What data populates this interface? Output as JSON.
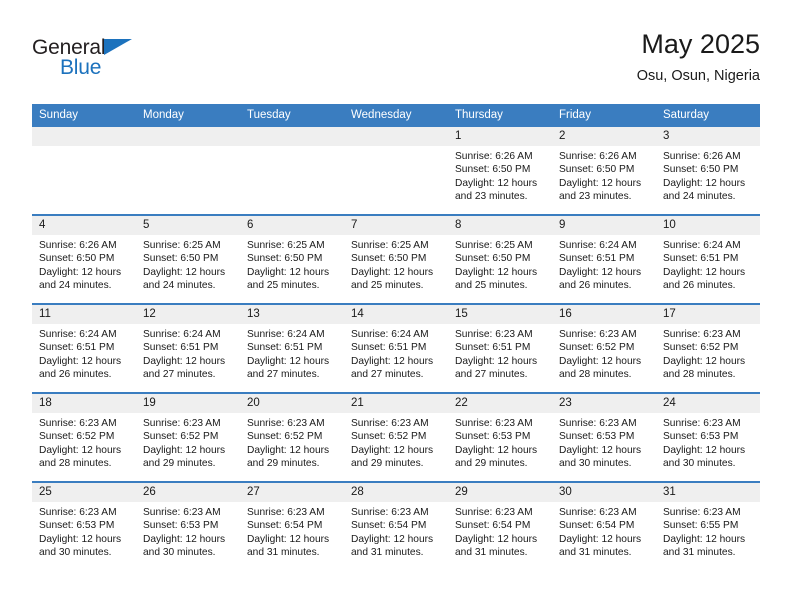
{
  "brand": {
    "name_part1": "General",
    "name_part2": "Blue",
    "triangle_icon": "triangle-icon",
    "accent_color": "#1c72bd"
  },
  "header": {
    "title": "May 2025",
    "location": "Osu, Osun, Nigeria"
  },
  "calendar": {
    "header_background": "#3a7dc0",
    "daynum_background": "#efefef",
    "weekday_headers": [
      "Sunday",
      "Monday",
      "Tuesday",
      "Wednesday",
      "Thursday",
      "Friday",
      "Saturday"
    ],
    "weeks": [
      [
        {
          "day": "",
          "sunrise": "",
          "sunset": "",
          "daylight": "",
          "empty": true
        },
        {
          "day": "",
          "sunrise": "",
          "sunset": "",
          "daylight": "",
          "empty": true
        },
        {
          "day": "",
          "sunrise": "",
          "sunset": "",
          "daylight": "",
          "empty": true
        },
        {
          "day": "",
          "sunrise": "",
          "sunset": "",
          "daylight": "",
          "empty": true
        },
        {
          "day": "1",
          "sunrise": "Sunrise: 6:26 AM",
          "sunset": "Sunset: 6:50 PM",
          "daylight": "Daylight: 12 hours and 23 minutes."
        },
        {
          "day": "2",
          "sunrise": "Sunrise: 6:26 AM",
          "sunset": "Sunset: 6:50 PM",
          "daylight": "Daylight: 12 hours and 23 minutes."
        },
        {
          "day": "3",
          "sunrise": "Sunrise: 6:26 AM",
          "sunset": "Sunset: 6:50 PM",
          "daylight": "Daylight: 12 hours and 24 minutes."
        }
      ],
      [
        {
          "day": "4",
          "sunrise": "Sunrise: 6:26 AM",
          "sunset": "Sunset: 6:50 PM",
          "daylight": "Daylight: 12 hours and 24 minutes."
        },
        {
          "day": "5",
          "sunrise": "Sunrise: 6:25 AM",
          "sunset": "Sunset: 6:50 PM",
          "daylight": "Daylight: 12 hours and 24 minutes."
        },
        {
          "day": "6",
          "sunrise": "Sunrise: 6:25 AM",
          "sunset": "Sunset: 6:50 PM",
          "daylight": "Daylight: 12 hours and 25 minutes."
        },
        {
          "day": "7",
          "sunrise": "Sunrise: 6:25 AM",
          "sunset": "Sunset: 6:50 PM",
          "daylight": "Daylight: 12 hours and 25 minutes."
        },
        {
          "day": "8",
          "sunrise": "Sunrise: 6:25 AM",
          "sunset": "Sunset: 6:50 PM",
          "daylight": "Daylight: 12 hours and 25 minutes."
        },
        {
          "day": "9",
          "sunrise": "Sunrise: 6:24 AM",
          "sunset": "Sunset: 6:51 PM",
          "daylight": "Daylight: 12 hours and 26 minutes."
        },
        {
          "day": "10",
          "sunrise": "Sunrise: 6:24 AM",
          "sunset": "Sunset: 6:51 PM",
          "daylight": "Daylight: 12 hours and 26 minutes."
        }
      ],
      [
        {
          "day": "11",
          "sunrise": "Sunrise: 6:24 AM",
          "sunset": "Sunset: 6:51 PM",
          "daylight": "Daylight: 12 hours and 26 minutes."
        },
        {
          "day": "12",
          "sunrise": "Sunrise: 6:24 AM",
          "sunset": "Sunset: 6:51 PM",
          "daylight": "Daylight: 12 hours and 27 minutes."
        },
        {
          "day": "13",
          "sunrise": "Sunrise: 6:24 AM",
          "sunset": "Sunset: 6:51 PM",
          "daylight": "Daylight: 12 hours and 27 minutes."
        },
        {
          "day": "14",
          "sunrise": "Sunrise: 6:24 AM",
          "sunset": "Sunset: 6:51 PM",
          "daylight": "Daylight: 12 hours and 27 minutes."
        },
        {
          "day": "15",
          "sunrise": "Sunrise: 6:23 AM",
          "sunset": "Sunset: 6:51 PM",
          "daylight": "Daylight: 12 hours and 27 minutes."
        },
        {
          "day": "16",
          "sunrise": "Sunrise: 6:23 AM",
          "sunset": "Sunset: 6:52 PM",
          "daylight": "Daylight: 12 hours and 28 minutes."
        },
        {
          "day": "17",
          "sunrise": "Sunrise: 6:23 AM",
          "sunset": "Sunset: 6:52 PM",
          "daylight": "Daylight: 12 hours and 28 minutes."
        }
      ],
      [
        {
          "day": "18",
          "sunrise": "Sunrise: 6:23 AM",
          "sunset": "Sunset: 6:52 PM",
          "daylight": "Daylight: 12 hours and 28 minutes."
        },
        {
          "day": "19",
          "sunrise": "Sunrise: 6:23 AM",
          "sunset": "Sunset: 6:52 PM",
          "daylight": "Daylight: 12 hours and 29 minutes."
        },
        {
          "day": "20",
          "sunrise": "Sunrise: 6:23 AM",
          "sunset": "Sunset: 6:52 PM",
          "daylight": "Daylight: 12 hours and 29 minutes."
        },
        {
          "day": "21",
          "sunrise": "Sunrise: 6:23 AM",
          "sunset": "Sunset: 6:52 PM",
          "daylight": "Daylight: 12 hours and 29 minutes."
        },
        {
          "day": "22",
          "sunrise": "Sunrise: 6:23 AM",
          "sunset": "Sunset: 6:53 PM",
          "daylight": "Daylight: 12 hours and 29 minutes."
        },
        {
          "day": "23",
          "sunrise": "Sunrise: 6:23 AM",
          "sunset": "Sunset: 6:53 PM",
          "daylight": "Daylight: 12 hours and 30 minutes."
        },
        {
          "day": "24",
          "sunrise": "Sunrise: 6:23 AM",
          "sunset": "Sunset: 6:53 PM",
          "daylight": "Daylight: 12 hours and 30 minutes."
        }
      ],
      [
        {
          "day": "25",
          "sunrise": "Sunrise: 6:23 AM",
          "sunset": "Sunset: 6:53 PM",
          "daylight": "Daylight: 12 hours and 30 minutes."
        },
        {
          "day": "26",
          "sunrise": "Sunrise: 6:23 AM",
          "sunset": "Sunset: 6:53 PM",
          "daylight": "Daylight: 12 hours and 30 minutes."
        },
        {
          "day": "27",
          "sunrise": "Sunrise: 6:23 AM",
          "sunset": "Sunset: 6:54 PM",
          "daylight": "Daylight: 12 hours and 31 minutes."
        },
        {
          "day": "28",
          "sunrise": "Sunrise: 6:23 AM",
          "sunset": "Sunset: 6:54 PM",
          "daylight": "Daylight: 12 hours and 31 minutes."
        },
        {
          "day": "29",
          "sunrise": "Sunrise: 6:23 AM",
          "sunset": "Sunset: 6:54 PM",
          "daylight": "Daylight: 12 hours and 31 minutes."
        },
        {
          "day": "30",
          "sunrise": "Sunrise: 6:23 AM",
          "sunset": "Sunset: 6:54 PM",
          "daylight": "Daylight: 12 hours and 31 minutes."
        },
        {
          "day": "31",
          "sunrise": "Sunrise: 6:23 AM",
          "sunset": "Sunset: 6:55 PM",
          "daylight": "Daylight: 12 hours and 31 minutes."
        }
      ]
    ]
  }
}
